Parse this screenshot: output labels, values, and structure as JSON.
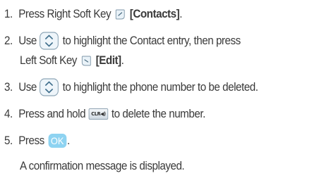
{
  "steps": [
    {
      "number": "1.",
      "pre": "Press Right Soft Key",
      "icon": "right-soft-key-icon",
      "bold": "[Contacts]",
      "post": "."
    },
    {
      "number": "2.",
      "pre": "Use",
      "icon": "navigation-key-icon",
      "post": "to highlight the Contact entry, then press",
      "cont_pre": "Left Soft Key",
      "cont_icon": "left-soft-key-icon",
      "cont_bold": "[Edit]",
      "cont_post": "."
    },
    {
      "number": "3.",
      "pre": "Use",
      "icon": "navigation-key-icon",
      "post": "to highlight the phone number to be deleted."
    },
    {
      "number": "4.",
      "pre": "Press and hold",
      "icon": "clr-key-icon",
      "key_label": "CLR◀)",
      "post": "to delete the number."
    },
    {
      "number": "5.",
      "pre": "Press",
      "icon": "ok-key-icon",
      "key_label": "OK",
      "post": ".",
      "note": "A confirmation message is displayed."
    }
  ]
}
